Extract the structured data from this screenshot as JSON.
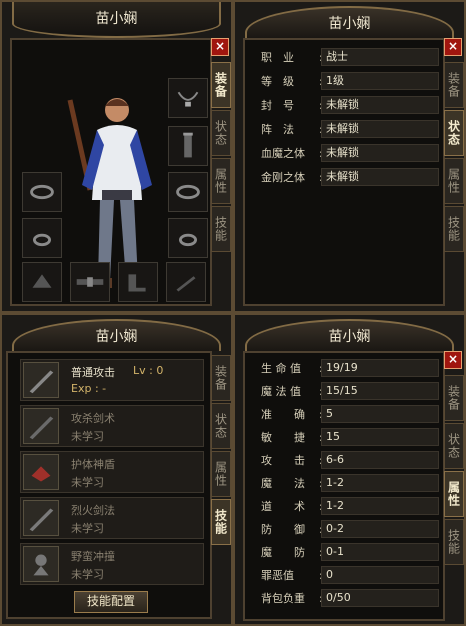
{
  "character_name": "苗小娴",
  "tabs": [
    "装备",
    "状态",
    "属性",
    "技能"
  ],
  "close_label": "×",
  "info": [
    {
      "label": "职　业",
      "value": "战士"
    },
    {
      "label": "等　级",
      "value": "1级"
    },
    {
      "label": "封　号",
      "value": "未解锁"
    },
    {
      "label": "阵　法",
      "value": "未解锁"
    },
    {
      "label": "血魔之体",
      "value": "未解锁"
    },
    {
      "label": "金刚之体",
      "value": "未解锁"
    }
  ],
  "skills": [
    {
      "name": "普通攻击",
      "lv": "Lv : 0",
      "exp": "Exp :  -"
    },
    {
      "name": "攻杀剑术",
      "status": "未学习"
    },
    {
      "name": "护体神盾",
      "status": "未学习"
    },
    {
      "name": "烈火剑法",
      "status": "未学习"
    },
    {
      "name": "野蛮冲撞",
      "status": "未学习"
    }
  ],
  "skill_config_button": "技能配置",
  "attributes": [
    {
      "label": "生 命 值",
      "value": "19/19"
    },
    {
      "label": "魔 法 值",
      "value": "15/15"
    },
    {
      "label": "准　　确",
      "value": "5"
    },
    {
      "label": "敏　　捷",
      "value": "15"
    },
    {
      "label": "攻　　击",
      "value": "6-6"
    },
    {
      "label": "魔　　法",
      "value": "1-2"
    },
    {
      "label": "道　　术",
      "value": "1-2"
    },
    {
      "label": "防　　御",
      "value": "0-2"
    },
    {
      "label": "魔　　防",
      "value": "0-1"
    },
    {
      "label": "罪恶值",
      "value": "0"
    },
    {
      "label": "背包负重",
      "value": "0/50"
    }
  ],
  "colors": {
    "panel": "#1c1a17",
    "border": "#826b45",
    "accent": "#d3b46a",
    "close": "#a0160f"
  },
  "icons": [
    "necklace-icon",
    "bottle-icon",
    "bracelet-icon",
    "ring-icon",
    "boots-icon",
    "belt-icon",
    "helmet-icon",
    "sword-icon"
  ]
}
